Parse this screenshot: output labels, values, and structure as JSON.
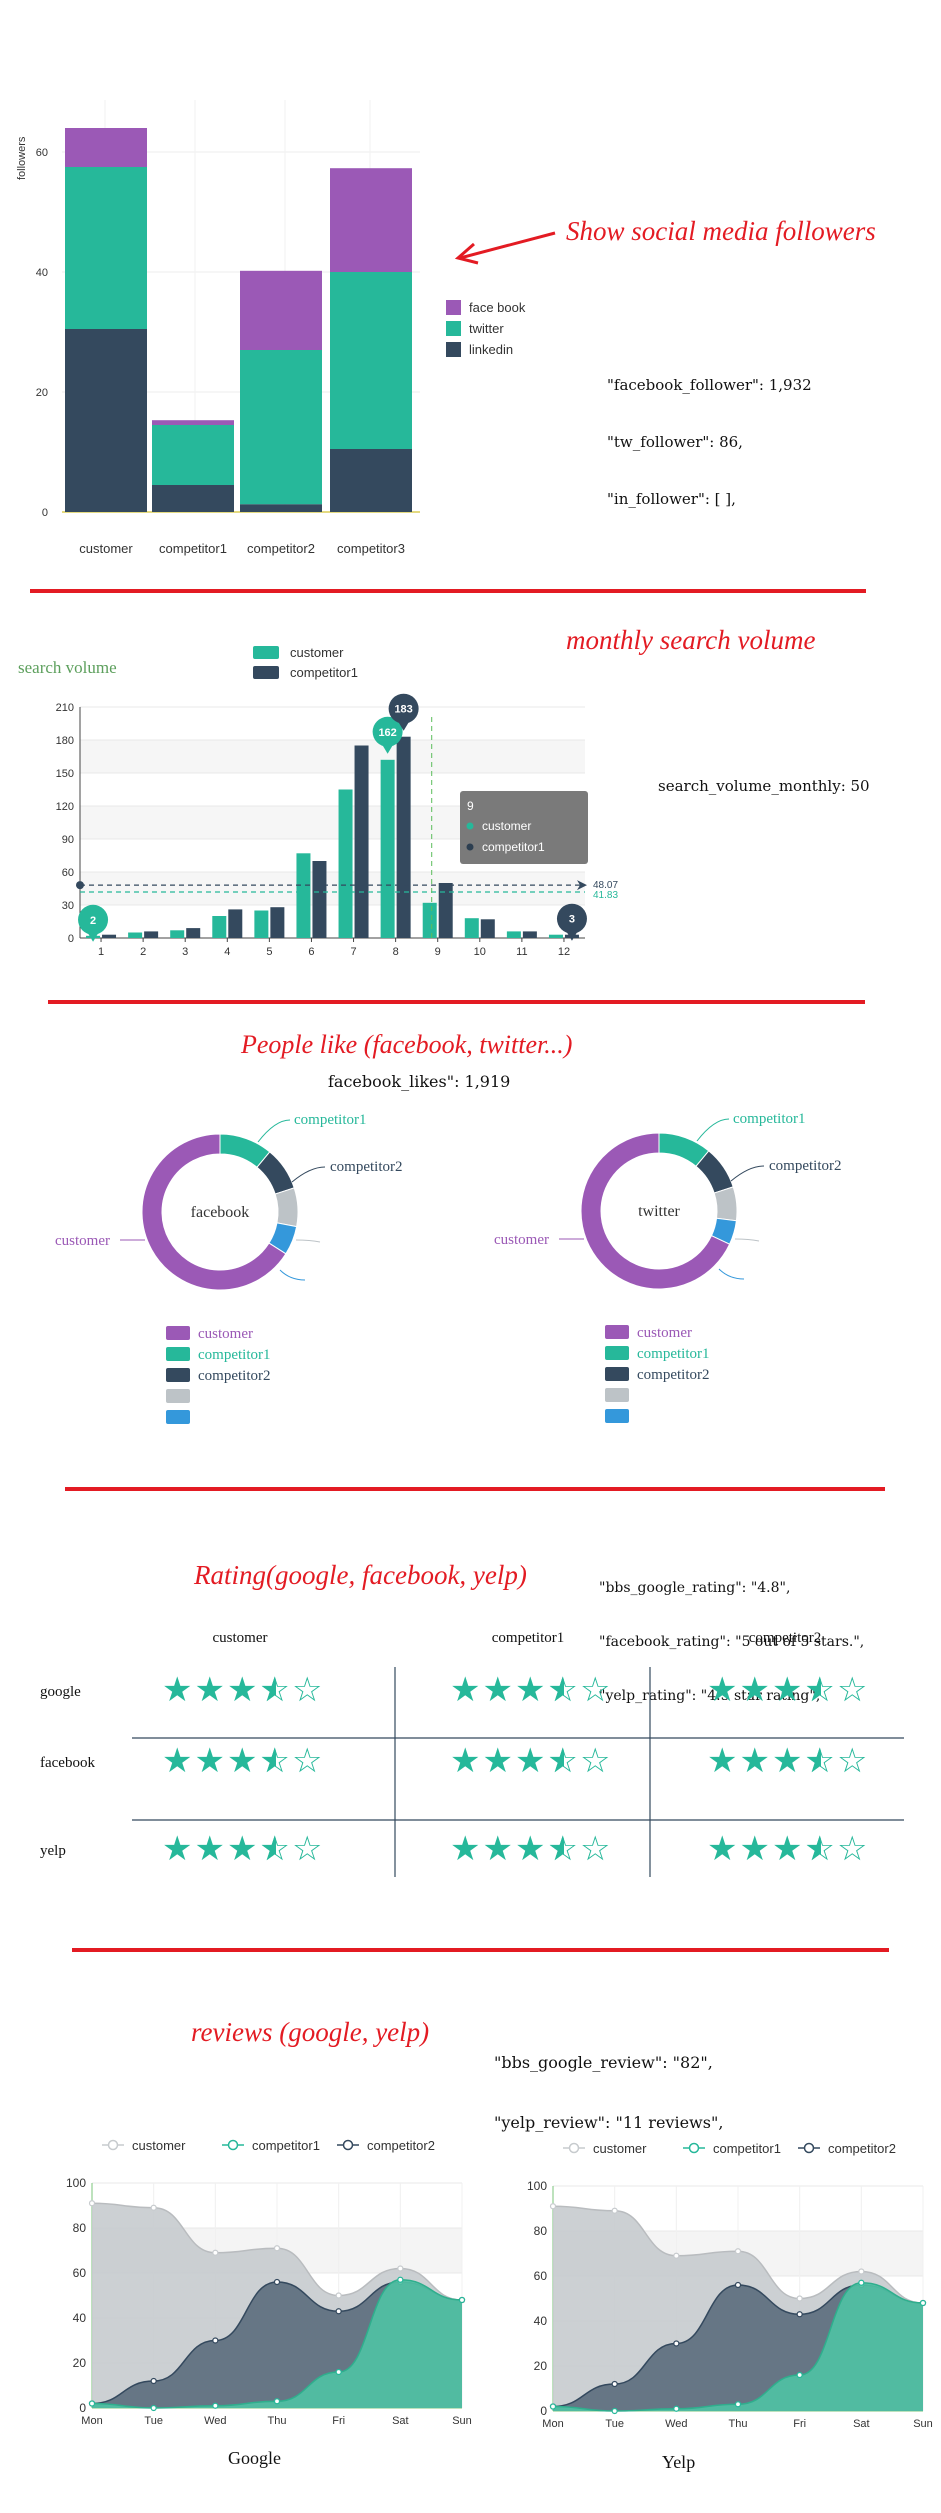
{
  "colors": {
    "customer": "#9b59b6",
    "twitter": "#26b89a",
    "linkedin": "#34495e",
    "teal": "#26b89a",
    "navy": "#34495e",
    "purple": "#9b59b6",
    "grey": "#bdc3c7",
    "blue": "#3498db",
    "red": "#e31b23"
  },
  "section1": {
    "annotation": "Show social media followers",
    "code_lines": [
      "\"facebook_follower\": 1,932",
      "\"tw_follower\": 86,",
      "\"in_follower\": [ ],"
    ]
  },
  "section2": {
    "title": "monthly search volume",
    "side_label": "search volume",
    "code_line": "search_volume_monthly: 50",
    "tooltip": {
      "header": "9",
      "rows": [
        "customer",
        "competitor1"
      ]
    },
    "markers": {
      "min_customer": "2",
      "min_competitor": "3",
      "max_customer": "162",
      "max_competitor": "183"
    },
    "avg_labels": [
      "48.07",
      "41.83"
    ]
  },
  "section3": {
    "title": "People like (facebook, twitter...)",
    "code_line": "facebook_likes\": 1,919",
    "donut_left": {
      "center": "facebook",
      "labels": [
        "competitor1",
        "competitor2",
        "customer"
      ]
    },
    "donut_right": {
      "center": "twitter",
      "labels": [
        "competitor1",
        "competitor2",
        "customer"
      ]
    },
    "legend": [
      "customer",
      "competitor1",
      "competitor2",
      "",
      ""
    ]
  },
  "section4": {
    "title": "Rating(google, facebook, yelp)",
    "code_lines": [
      "\"bbs_google_rating\": \"4.8\",",
      "\"facebook_rating\": \"5 out of 5 stars.\",",
      "\"yelp_rating\": \"4.5 star rating\","
    ],
    "columns": [
      "customer",
      "competitor1",
      "competitor2"
    ],
    "rows": [
      "google",
      "facebook",
      "yelp"
    ],
    "rating_value": 3.5,
    "rating_max": 5
  },
  "section5": {
    "title": "reviews (google, yelp)",
    "code_lines": [
      "\"bbs_google_review\": \"82\",",
      "\"yelp_review\": \"11 reviews\","
    ],
    "left_caption": "Google",
    "right_caption": "Yelp"
  },
  "chart_data": [
    {
      "type": "bar",
      "stacked": true,
      "categories": [
        "customer",
        "competitor1",
        "competitor2",
        "competitor3"
      ],
      "series": [
        {
          "name": "linkedin",
          "values": [
            30.5,
            4.5,
            1.3,
            10.5
          ]
        },
        {
          "name": "twitter",
          "values": [
            27,
            10,
            25.7,
            29.5
          ]
        },
        {
          "name": "face book",
          "values": [
            6.5,
            0.8,
            13.2,
            17.3
          ]
        }
      ],
      "ylabel": "followers",
      "ylim": [
        0,
        68
      ],
      "yticks": [
        0,
        20,
        40,
        60
      ],
      "legend": "right"
    },
    {
      "type": "bar",
      "categories": [
        "1",
        "2",
        "3",
        "4",
        "5",
        "6",
        "7",
        "8",
        "9",
        "10",
        "11",
        "12"
      ],
      "series": [
        {
          "name": "customer",
          "values": [
            2,
            5,
            7,
            20,
            25,
            77,
            135,
            162,
            32,
            18,
            6,
            3
          ]
        },
        {
          "name": "competitor1",
          "values": [
            3,
            6,
            9,
            26,
            28,
            70,
            175,
            183,
            50,
            17,
            6,
            3
          ]
        }
      ],
      "ylim": [
        0,
        210
      ],
      "yticks": [
        0,
        30,
        60,
        90,
        120,
        150,
        180,
        210
      ],
      "averages": {
        "competitor1": 48.07,
        "customer": 41.83
      },
      "legend": "top"
    },
    {
      "type": "pie",
      "name": "facebook",
      "series": [
        {
          "name": "customer",
          "value": 66
        },
        {
          "name": "competitor1",
          "value": 11
        },
        {
          "name": "competitor2",
          "value": 9
        },
        {
          "name": "",
          "value": 8
        },
        {
          "name": "",
          "value": 6
        }
      ]
    },
    {
      "type": "pie",
      "name": "twitter",
      "series": [
        {
          "name": "customer",
          "value": 68
        },
        {
          "name": "competitor1",
          "value": 11
        },
        {
          "name": "competitor2",
          "value": 9
        },
        {
          "name": "",
          "value": 7
        },
        {
          "name": "",
          "value": 5
        }
      ]
    },
    {
      "type": "area",
      "name": "Google",
      "categories": [
        "Mon",
        "Tue",
        "Wed",
        "Thu",
        "Fri",
        "Sat",
        "Sun"
      ],
      "series": [
        {
          "name": "customer",
          "values": [
            91,
            89,
            69,
            71,
            50,
            62,
            48
          ]
        },
        {
          "name": "competitor1",
          "values": [
            2,
            0,
            1,
            3,
            16,
            57,
            48
          ]
        },
        {
          "name": "competitor2",
          "values": [
            2,
            12,
            30,
            56,
            43,
            56,
            48
          ]
        }
      ],
      "ylim": [
        0,
        100
      ],
      "yticks": [
        0,
        20,
        40,
        60,
        80,
        100
      ],
      "legend": "top"
    },
    {
      "type": "area",
      "name": "Yelp",
      "categories": [
        "Mon",
        "Tue",
        "Wed",
        "Thu",
        "Fri",
        "Sat",
        "Sun"
      ],
      "series": [
        {
          "name": "customer",
          "values": [
            91,
            89,
            69,
            71,
            50,
            62,
            48
          ]
        },
        {
          "name": "competitor1",
          "values": [
            2,
            0,
            1,
            3,
            16,
            57,
            48
          ]
        },
        {
          "name": "competitor2",
          "values": [
            2,
            12,
            30,
            56,
            43,
            56,
            48
          ]
        }
      ],
      "ylim": [
        0,
        100
      ],
      "yticks": [
        0,
        20,
        40,
        60,
        80,
        100
      ],
      "legend": "top"
    }
  ]
}
